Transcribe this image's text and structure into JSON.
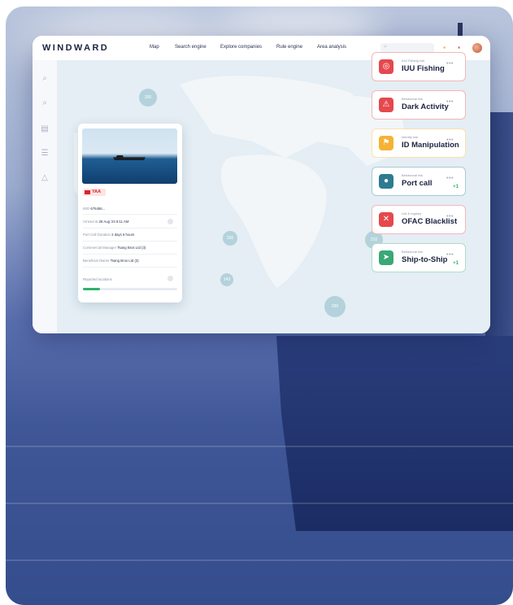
{
  "header": {
    "logo": "WINDWARD",
    "nav": [
      "Map",
      "Search engine",
      "Explore companies",
      "Rule engine",
      "Area analysis"
    ]
  },
  "vessel_card": {
    "flag_label": "YAA",
    "rows": [
      {
        "label": "IMO",
        "value": "676456..."
      },
      {
        "label": "Arrived at",
        "value": "28 Aug '23 8:11 AM"
      },
      {
        "label": "Port Call Duration",
        "value": "2 days 6 hours"
      },
      {
        "label": "Commercial Manager",
        "value": "Tsang Bros Ltd (3)"
      },
      {
        "label": "Beneficial Owner",
        "value": "Tsang Bros Ltd (3)"
      }
    ],
    "reported_locations": "Reported locations"
  },
  "map_clusters": [
    "200",
    "150",
    "143",
    "210",
    "200",
    "150"
  ],
  "risks": [
    {
      "category": "IUU Fishing risk",
      "title": "IUU Fishing",
      "color": "#e5484d",
      "icon": "fish-icon",
      "extra": ""
    },
    {
      "category": "Behavioral risk",
      "title": "Dark Activity",
      "color": "#e5484d",
      "icon": "warning-icon",
      "extra": ""
    },
    {
      "category": "Identity risk",
      "title": "ID Manipulation",
      "color": "#f5b335",
      "icon": "flag-icon",
      "extra": ""
    },
    {
      "category": "Behavioral risk",
      "title": "Port call",
      "color": "#2e7b8f",
      "icon": "pin-icon",
      "extra": "+1"
    },
    {
      "category": "List & registry",
      "title": "OFAC Blacklist",
      "color": "#e5484d",
      "icon": "close-icon",
      "extra": ""
    },
    {
      "category": "Behavioral risk",
      "title": "Ship-to-Ship",
      "color": "#3aa876",
      "icon": "send-icon",
      "extra": "+1"
    }
  ]
}
